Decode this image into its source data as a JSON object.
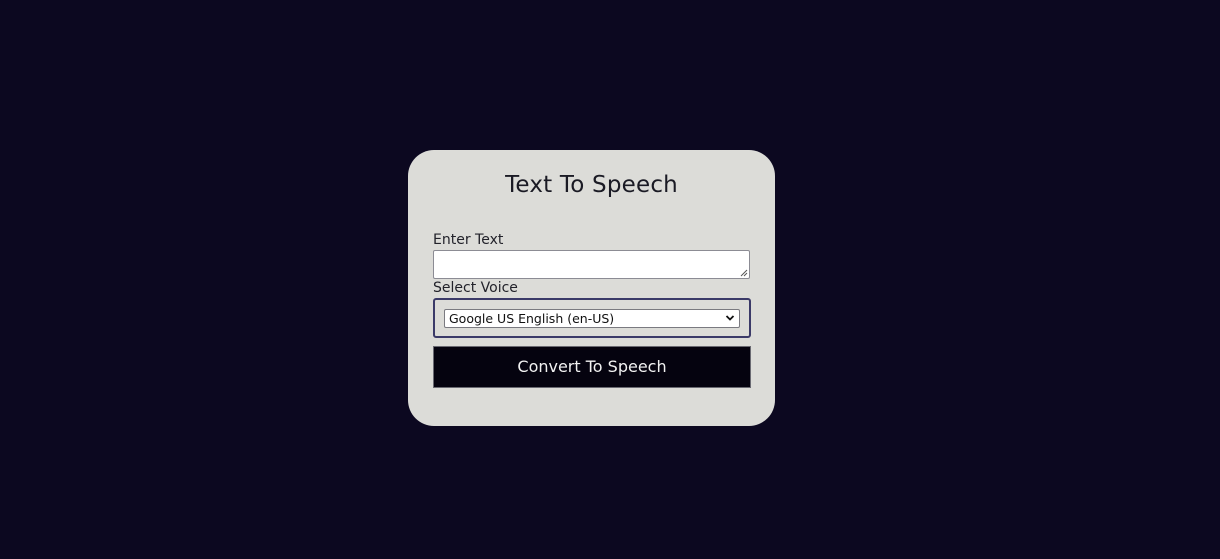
{
  "page": {
    "title": "Text To Speech"
  },
  "form": {
    "text_label": "Enter Text",
    "text_value": "",
    "voice_label": "Select Voice",
    "voice_selected": "Google US English (en-US)",
    "submit_label": "Convert To Speech"
  },
  "icons": {
    "resize": "resize-grip-icon",
    "select_arrow": "chevron-down-icon"
  },
  "colors": {
    "background": "#0c0820",
    "card": "#dcdcd8",
    "button": "#05030f",
    "select_border": "#3b3a68"
  }
}
